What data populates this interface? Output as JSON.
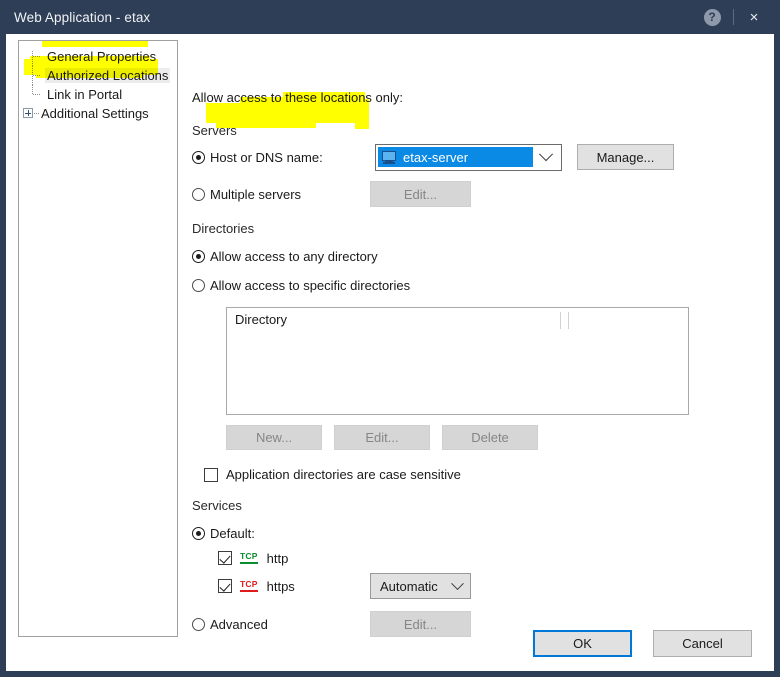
{
  "window": {
    "title": "Web Application - etax",
    "help_icon": "help-circle-icon",
    "close_icon": "close-icon",
    "help_glyph": "?",
    "close_glyph": "×"
  },
  "tree": {
    "items": [
      {
        "label": "General Properties",
        "selected": false,
        "expandable": false
      },
      {
        "label": "Authorized Locations",
        "selected": true,
        "expandable": false
      },
      {
        "label": "Link in Portal",
        "selected": false,
        "expandable": false
      },
      {
        "label": "Additional Settings",
        "selected": false,
        "expandable": true
      }
    ]
  },
  "main": {
    "intro": "Allow access to these locations only:",
    "servers": {
      "group_label": "Servers",
      "host_radio_label": "Host or DNS name:",
      "host_radio_selected": true,
      "host_value": "etax-server",
      "host_icon": "computer-icon",
      "manage_button": "Manage...",
      "multiple_radio_label": "Multiple servers",
      "multiple_radio_selected": false,
      "multiple_edit_button": "Edit...",
      "multiple_edit_disabled": true
    },
    "directories": {
      "group_label": "Directories",
      "any_radio_label": "Allow access to any directory",
      "any_radio_selected": true,
      "specific_radio_label": "Allow access to specific directories",
      "specific_radio_selected": false,
      "list_header": "Directory",
      "list_rows": [],
      "new_button": "New...",
      "edit_button": "Edit...",
      "delete_button": "Delete",
      "buttons_disabled": true,
      "case_sensitive_label": "Application directories are case sensitive",
      "case_sensitive_checked": false
    },
    "services": {
      "group_label": "Services",
      "default_radio_label": "Default:",
      "default_radio_selected": true,
      "entries": [
        {
          "label": "http",
          "checked": true,
          "protocol": "TCP",
          "protocol_color": "#0a8f2e"
        },
        {
          "label": "https",
          "checked": true,
          "protocol": "TCP",
          "protocol_color": "#e01b1b"
        }
      ],
      "https_mode": "Automatic",
      "advanced_radio_label": "Advanced",
      "advanced_radio_selected": false,
      "advanced_edit_button": "Edit...",
      "advanced_edit_disabled": true
    }
  },
  "footer": {
    "ok_button": "OK",
    "cancel_button": "Cancel"
  },
  "annotations": {
    "highlight_color": "#ffff00",
    "marks": [
      "authorized-locations-tree-item",
      "host-or-dns-name-row"
    ]
  }
}
